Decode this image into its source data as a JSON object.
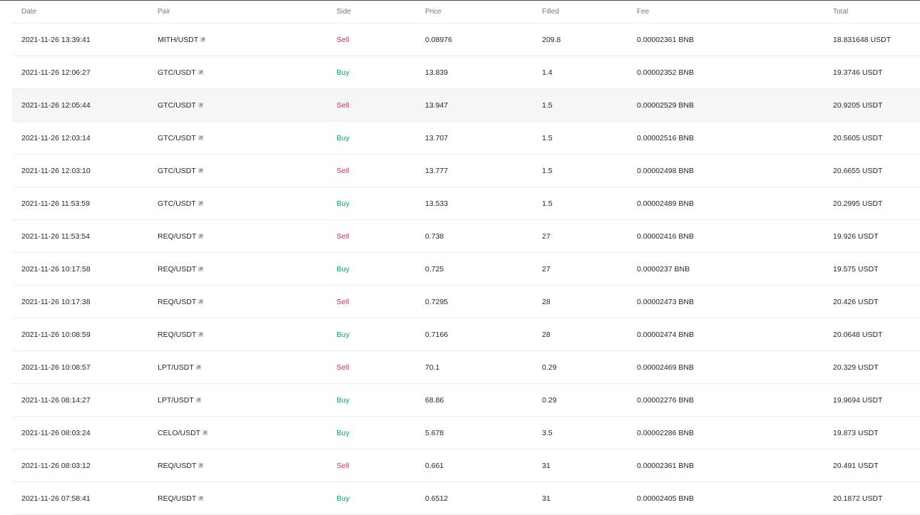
{
  "columns": {
    "date": "Date",
    "pair": "Pair",
    "side": "Side",
    "price": "Price",
    "filled": "Filled",
    "fee": "Fee",
    "total": "Total"
  },
  "colors": {
    "buy": "#03a66d",
    "sell": "#cf304a",
    "header_text": "#707a8a",
    "divider": "#eaecef",
    "highlight_row": "#f5f5f5"
  },
  "icons": {
    "pair_link": "external-link-icon"
  },
  "rows": [
    {
      "date": "2021-11-26 13:39:41",
      "pair": "MITH/USDT",
      "side": "Sell",
      "price": "0.08976",
      "filled": "209.8",
      "fee": "0.00002361 BNB",
      "total": "18.831648 USDT"
    },
    {
      "date": "2021-11-26 12:06:27",
      "pair": "GTC/USDT",
      "side": "Buy",
      "price": "13.839",
      "filled": "1.4",
      "fee": "0.00002352 BNB",
      "total": "19.3746 USDT"
    },
    {
      "date": "2021-11-26 12:05:44",
      "pair": "GTC/USDT",
      "side": "Sell",
      "price": "13.947",
      "filled": "1.5",
      "fee": "0.00002529 BNB",
      "total": "20.9205 USDT",
      "highlighted": true
    },
    {
      "date": "2021-11-26 12:03:14",
      "pair": "GTC/USDT",
      "side": "Buy",
      "price": "13.707",
      "filled": "1.5",
      "fee": "0.00002516 BNB",
      "total": "20.5605 USDT"
    },
    {
      "date": "2021-11-26 12:03:10",
      "pair": "GTC/USDT",
      "side": "Sell",
      "price": "13.777",
      "filled": "1.5",
      "fee": "0.00002498 BNB",
      "total": "20.6655 USDT"
    },
    {
      "date": "2021-11-26 11:53:59",
      "pair": "GTC/USDT",
      "side": "Buy",
      "price": "13.533",
      "filled": "1.5",
      "fee": "0.00002489 BNB",
      "total": "20.2995 USDT"
    },
    {
      "date": "2021-11-26 11:53:54",
      "pair": "REQ/USDT",
      "side": "Sell",
      "price": "0.738",
      "filled": "27",
      "fee": "0.00002416 BNB",
      "total": "19.926 USDT"
    },
    {
      "date": "2021-11-26 10:17:58",
      "pair": "REQ/USDT",
      "side": "Buy",
      "price": "0.725",
      "filled": "27",
      "fee": "0.0000237 BNB",
      "total": "19.575 USDT"
    },
    {
      "date": "2021-11-26 10:17:38",
      "pair": "REQ/USDT",
      "side": "Sell",
      "price": "0.7295",
      "filled": "28",
      "fee": "0.00002473 BNB",
      "total": "20.426 USDT"
    },
    {
      "date": "2021-11-26 10:08:59",
      "pair": "REQ/USDT",
      "side": "Buy",
      "price": "0.7166",
      "filled": "28",
      "fee": "0.00002474 BNB",
      "total": "20.0648 USDT"
    },
    {
      "date": "2021-11-26 10:08:57",
      "pair": "LPT/USDT",
      "side": "Sell",
      "price": "70.1",
      "filled": "0.29",
      "fee": "0.00002469 BNB",
      "total": "20.329 USDT"
    },
    {
      "date": "2021-11-26 08:14:27",
      "pair": "LPT/USDT",
      "side": "Buy",
      "price": "68.86",
      "filled": "0.29",
      "fee": "0.00002276 BNB",
      "total": "19.9694 USDT"
    },
    {
      "date": "2021-11-26 08:03:24",
      "pair": "CELO/USDT",
      "side": "Buy",
      "price": "5.678",
      "filled": "3.5",
      "fee": "0.00002286 BNB",
      "total": "19.873 USDT"
    },
    {
      "date": "2021-11-26 08:03:12",
      "pair": "REQ/USDT",
      "side": "Sell",
      "price": "0.661",
      "filled": "31",
      "fee": "0.00002361 BNB",
      "total": "20.491 USDT"
    },
    {
      "date": "2021-11-26 07:58:41",
      "pair": "REQ/USDT",
      "side": "Buy",
      "price": "0.6512",
      "filled": "31",
      "fee": "0.00002405 BNB",
      "total": "20.1872 USDT"
    }
  ]
}
